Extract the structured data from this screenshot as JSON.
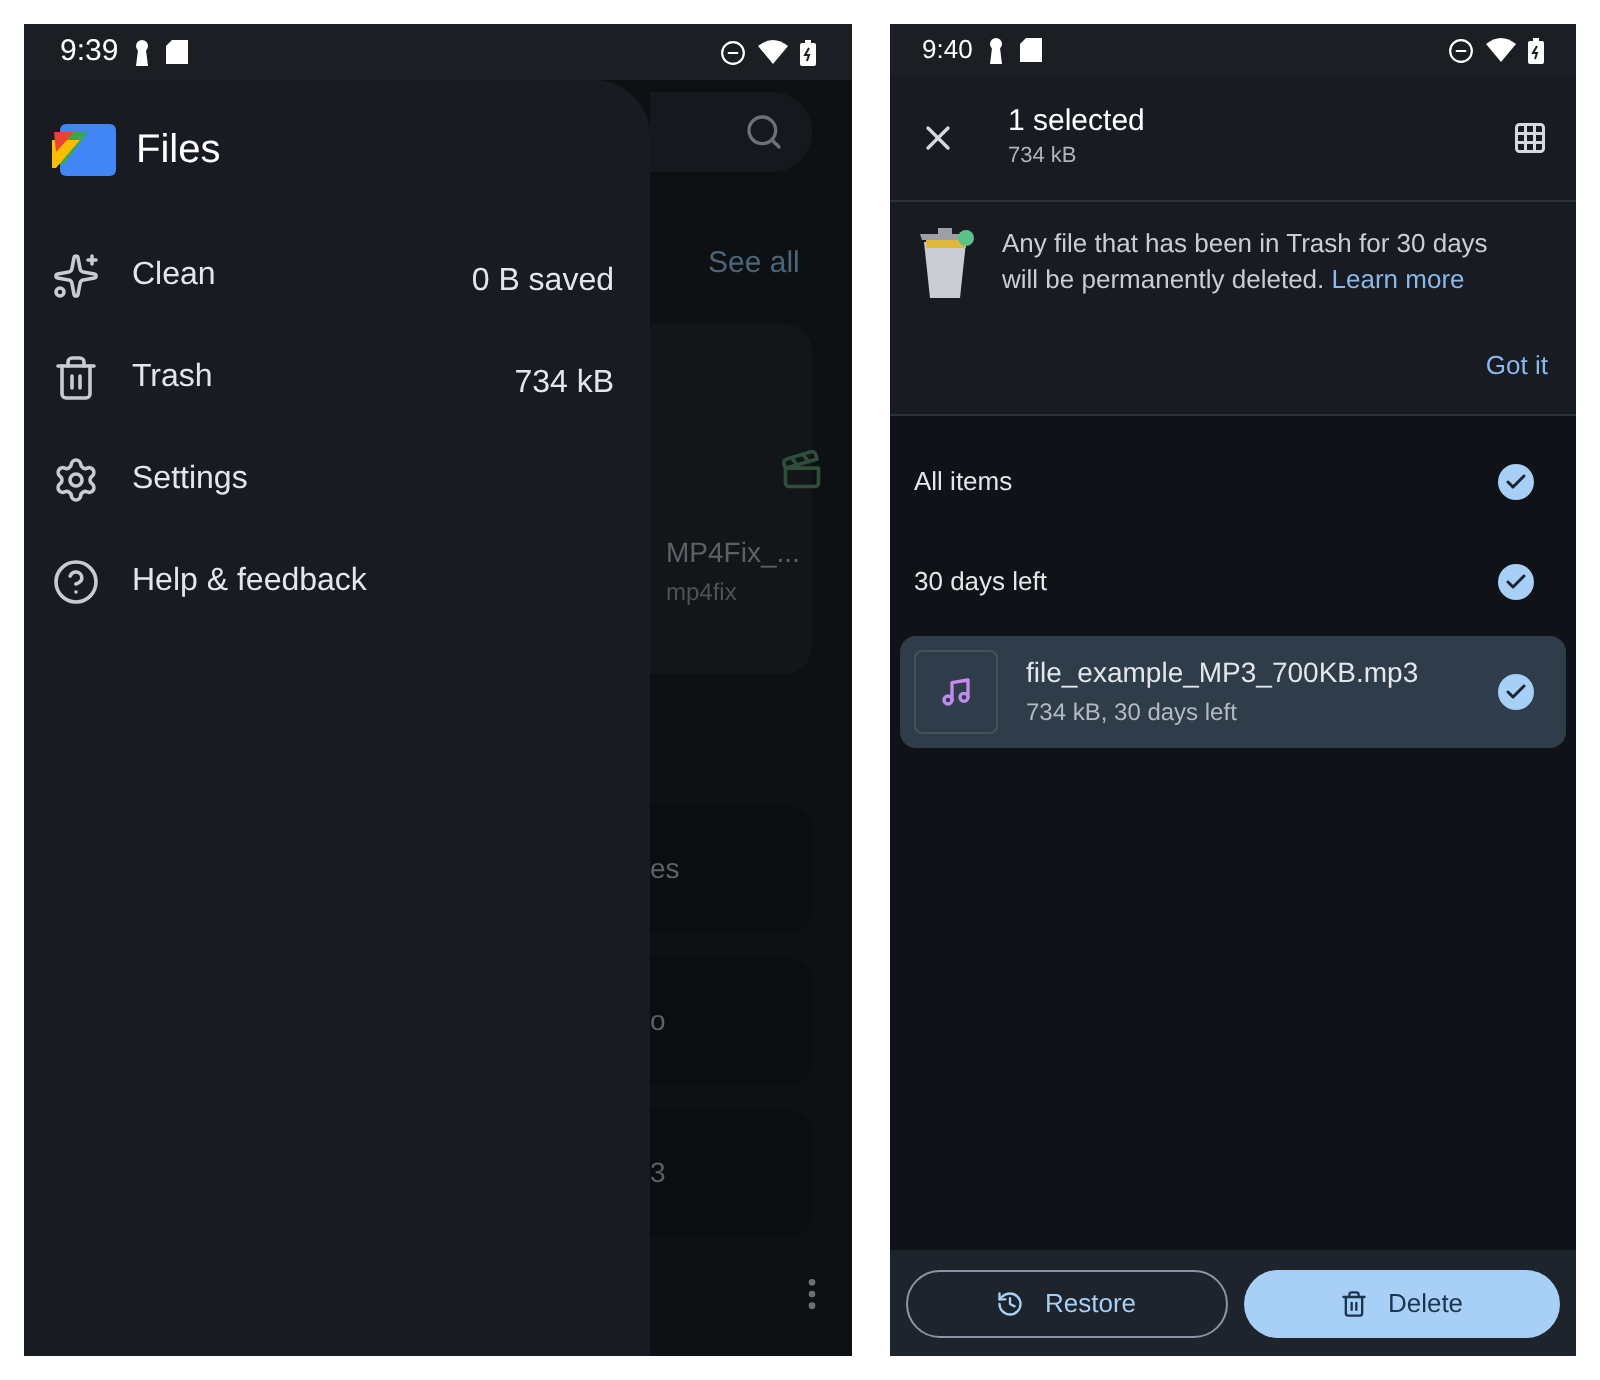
{
  "left_screen": {
    "status_bar": {
      "time": "9:39"
    },
    "drawer": {
      "app_title": "Files",
      "items": [
        {
          "kind": "clean",
          "label": "Clean",
          "value": "0 B saved"
        },
        {
          "kind": "trash",
          "label": "Trash",
          "value": "734 kB"
        },
        {
          "kind": "settings",
          "label": "Settings"
        },
        {
          "kind": "help",
          "label": "Help & feedback"
        }
      ]
    },
    "background": {
      "see_all": "See all",
      "file_card": {
        "name": "MP4Fix_...",
        "subtitle": "mp4fix"
      },
      "partial_texts": [
        "es",
        "o",
        "3"
      ]
    }
  },
  "right_screen": {
    "status_bar": {
      "time": "9:40"
    },
    "action_bar": {
      "title": "1 selected",
      "subtitle": "734 kB"
    },
    "banner": {
      "message": "Any file that has been in Trash for 30 days will be permanently deleted.",
      "link": "Learn more",
      "dismiss": "Got it"
    },
    "groups": [
      {
        "label": "All items",
        "checked": true
      },
      {
        "label": "30 days left",
        "checked": true
      }
    ],
    "files": [
      {
        "name": "file_example_MP3_700KB.mp3",
        "details": "734 kB, 30 days left",
        "selected": true,
        "checked": true
      }
    ],
    "buttons": [
      {
        "kind": "restore",
        "label": "Restore"
      },
      {
        "kind": "delete",
        "label": "Delete"
      }
    ]
  }
}
